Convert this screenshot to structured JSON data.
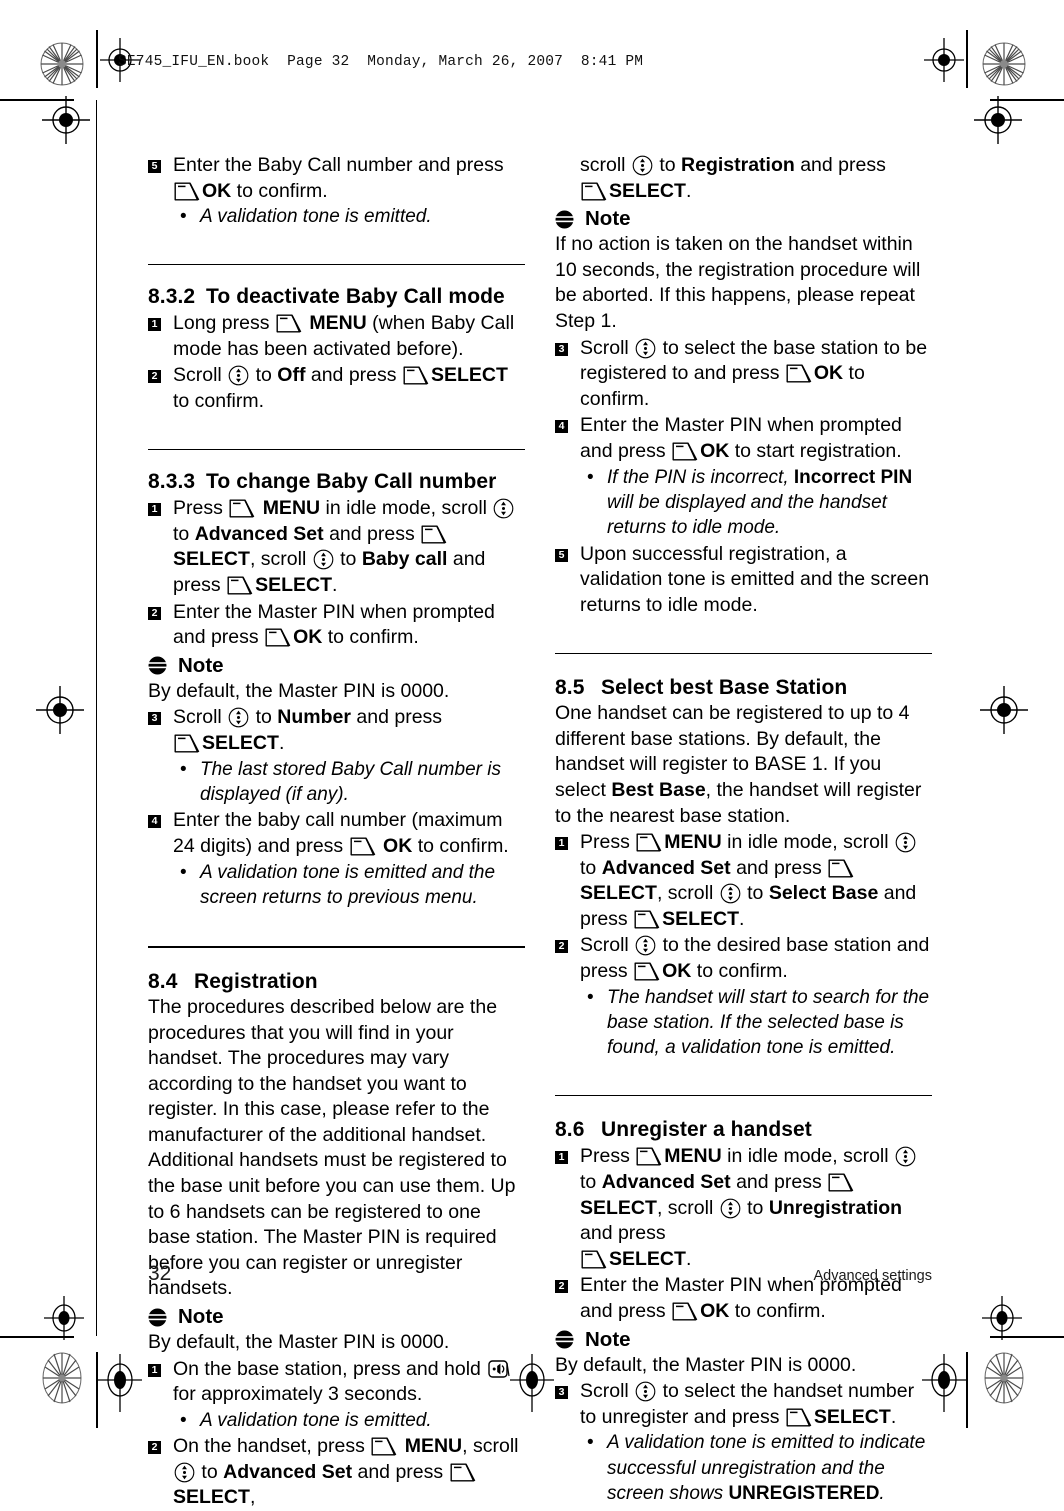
{
  "document": {
    "slug": "SE745_IFU_EN.book  Page 32  Monday, March 26, 2007  8:41 PM",
    "page_number": "32",
    "footer_right": "Advanced settings"
  },
  "icons": {
    "softkey": "softkey-icon",
    "scroll": "scroll-updown-icon",
    "paging": "paging-button-icon",
    "note": "note-icon"
  },
  "left_column": {
    "step5": {
      "num": "5",
      "t1": "Enter the Baby Call number and press",
      "t2": "OK",
      "t3": " to confirm.",
      "bullet": "A validation tone is emitted."
    },
    "sec_832": {
      "number": "8.3.2",
      "title": "To deactivate Baby Call mode",
      "step1": {
        "num": "1",
        "t1": "Long press ",
        "t2": "MENU",
        "t3": " (when Baby Call mode has been activated before)."
      },
      "step2": {
        "num": "2",
        "t1": "Scroll ",
        "t2": " to ",
        "t3": "Off",
        "t4": " and press ",
        "t5": "SELECT",
        "t6": " to confirm."
      }
    },
    "sec_833": {
      "number": "8.3.3",
      "title": "To change Baby Call number",
      "step1": {
        "num": "1",
        "t1": "Press ",
        "t2": "MENU",
        "t3": " in idle mode, scroll ",
        "t4": " to ",
        "t5": "Advanced Set",
        "t6": " and press ",
        "t7": "SELECT",
        "t8": ", scroll ",
        "t9": " to ",
        "t10": "Baby call",
        "t11": " and press ",
        "t12": "SELECT",
        "t13": "."
      },
      "step2": {
        "num": "2",
        "t1": "Enter the Master PIN when prompted and press ",
        "t2": "OK",
        "t3": " to confirm."
      },
      "note_label": "Note",
      "note_text": "By default, the Master PIN is 0000.",
      "step3": {
        "num": "3",
        "t1": "Scroll ",
        "t2": " to ",
        "t3": "Number",
        "t4": " and press ",
        "t5": "SELECT",
        "t6": ".",
        "bullet": "The last stored Baby Call number is displayed (if any)."
      },
      "step4": {
        "num": "4",
        "t1": "Enter the baby call number (maximum 24 digits) and press ",
        "t2": "OK",
        "t3": " to confirm.",
        "bullet": "A validation tone is emitted and the screen returns to previous menu."
      }
    },
    "sec_84": {
      "number": "8.4",
      "title": "Registration",
      "para": "The procedures described below are the procedures that you will find in your handset. The procedures may vary according to the handset you want to register. In this case, please refer to the manufacturer of the additional handset. Additional handsets must be registered to the base unit before you can use them. Up to 6 handsets can be registered to one base station. The Master PIN is required before you can register or unregister handsets.",
      "note_label": "Note",
      "note_text": "By default, the Master PIN is 0000.",
      "step1": {
        "num": "1",
        "t1": "On the base station, press and hold ",
        "t2": " for approximately 3 seconds.",
        "bullet": "A validation tone is emitted."
      },
      "step2": {
        "num": "2",
        "t1": "On the handset, press ",
        "t2": "MENU",
        "t3": ", scroll ",
        "t4": " to ",
        "t5": "Advanced Set",
        "t6": " and press ",
        "t7": "SELECT",
        "t8": ","
      }
    }
  },
  "right_column": {
    "cont_step2": {
      "t1": "scroll ",
      "t2": " to ",
      "t3": "Registration",
      "t4": " and press ",
      "t5": "SELECT",
      "t6": "."
    },
    "note1_label": "Note",
    "note1_text": "If no action is taken on the handset within 10 seconds, the registration procedure will be aborted. If this happens, please repeat Step 1.",
    "step3": {
      "num": "3",
      "t1": "Scroll ",
      "t2": " to select the base station to be registered to and press ",
      "t3": "OK",
      "t4": " to confirm."
    },
    "step4": {
      "num": "4",
      "t1": "Enter the Master PIN when prompted and press ",
      "t2": "OK",
      "t3": " to start registration.",
      "b1": "If the PIN is incorrect, ",
      "b2": "Incorrect PIN",
      "b3": " will be displayed and the handset returns to idle mode."
    },
    "step5": {
      "num": "5",
      "t1": "Upon successful registration, a validation tone is emitted and the screen returns to idle mode."
    },
    "sec_85": {
      "number": "8.5",
      "title": "Select best Base Station",
      "p1": "One handset can be registered to up to 4 different base stations. By default, the handset will register to BASE 1. If you select ",
      "p2": "Best Base",
      "p3": ", the handset will register to the nearest base station.",
      "step1": {
        "num": "1",
        "t1": "Press ",
        "t2": "MENU",
        "t3": " in idle mode, scroll ",
        "t4": " to ",
        "t5": "Advanced Set",
        "t6": " and press ",
        "t7": "SELECT",
        "t8": ", scroll ",
        "t9": " to ",
        "t10": "Select Base",
        "t11": " and press ",
        "t12": "SELECT",
        "t13": "."
      },
      "step2": {
        "num": "2",
        "t1": "Scroll ",
        "t2": " to the desired base station and press ",
        "t3": "OK",
        "t4": " to confirm.",
        "bullet": "The handset will start to search for the base station. If the selected base is found, a validation tone is emitted."
      }
    },
    "sec_86": {
      "number": "8.6",
      "title": "Unregister a handset",
      "step1": {
        "num": "1",
        "t1": "Press ",
        "t2": "MENU",
        "t3": " in idle mode, scroll ",
        "t4": " to ",
        "t5": "Advanced Set",
        "t6": " and press ",
        "t7": "SELECT",
        "t8": ", scroll ",
        "t9": " to ",
        "t10": "Unregistration",
        "t11": " and press ",
        "t12": "SELECT",
        "t13": "."
      },
      "step2": {
        "num": "2",
        "t1": "Enter the Master PIN when prompted and press ",
        "t2": "OK",
        "t3": " to confirm."
      },
      "note_label": "Note",
      "note_text": "By default, the Master PIN is 0000.",
      "step3": {
        "num": "3",
        "t1": "Scroll ",
        "t2": " to select the handset number to unregister and press ",
        "t3": "SELECT",
        "t4": ".",
        "b1": "A validation tone is emitted to indicate successful unregistration and the screen shows ",
        "b2": "UNREGISTERED",
        "b3": "."
      }
    }
  }
}
